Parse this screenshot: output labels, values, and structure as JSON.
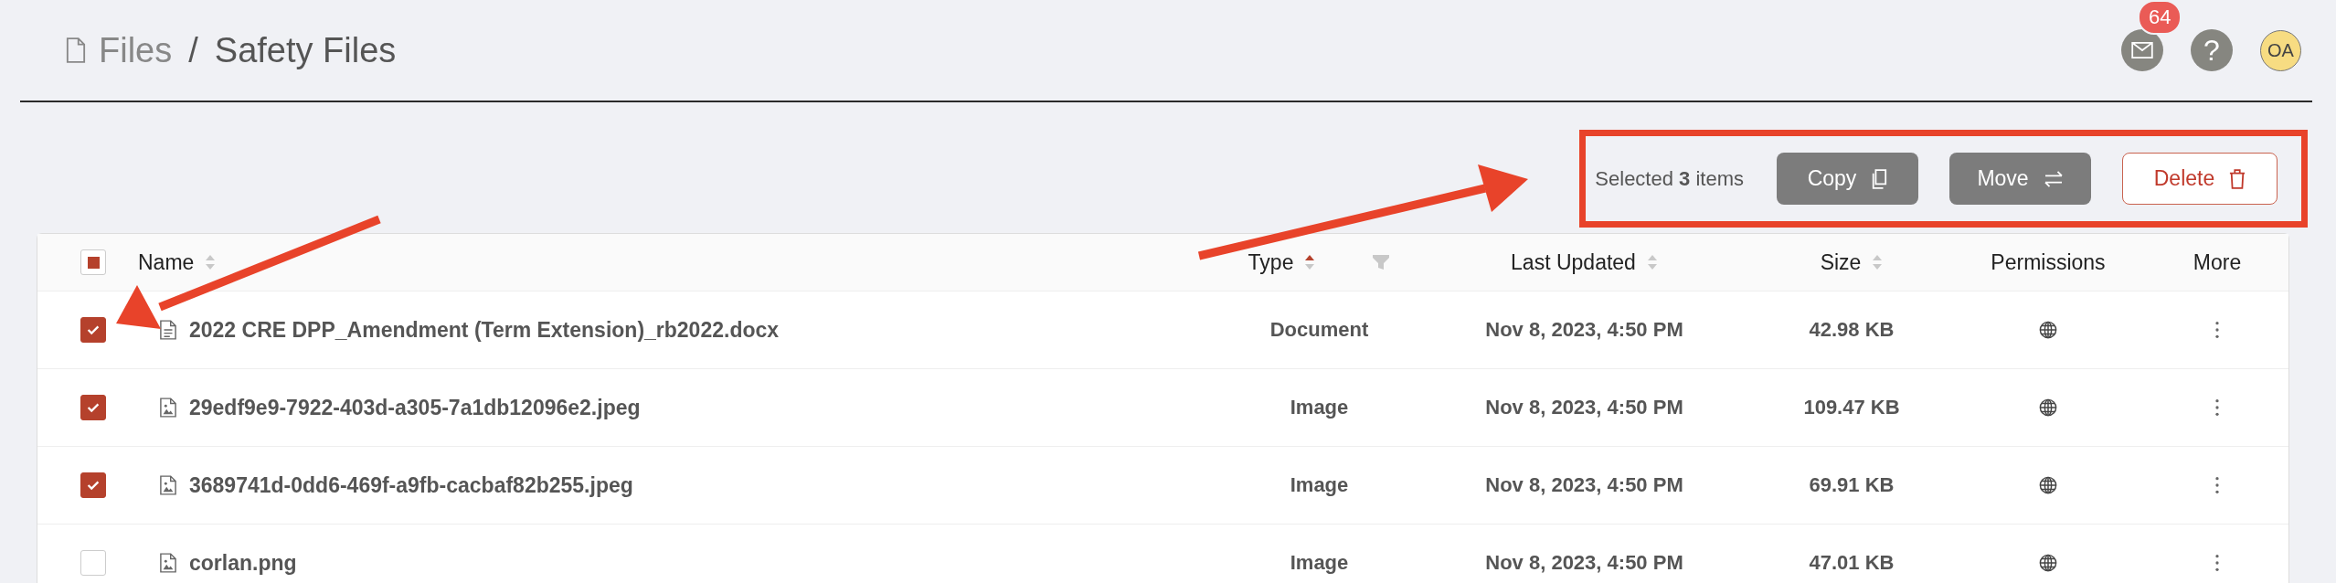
{
  "breadcrumb": {
    "root": "Files",
    "separator": "/",
    "current": "Safety Files"
  },
  "header_actions": {
    "mail_count": "64",
    "help": "?",
    "avatar": "OA"
  },
  "selection_bar": {
    "highlighted": true,
    "prefix": "Selected ",
    "count": "3",
    "suffix": " items",
    "buttons": [
      {
        "label": "Copy",
        "kind": "copy"
      },
      {
        "label": "Move",
        "kind": "move"
      },
      {
        "label": "Delete",
        "kind": "delete"
      }
    ]
  },
  "table": {
    "select_all": {
      "indeterminate": true
    },
    "columns": [
      {
        "label": "Name",
        "sortable": true,
        "sorted_ascending": false,
        "filter": false
      },
      {
        "label": "Type",
        "sortable": true,
        "sorted_ascending": true,
        "filter": true
      },
      {
        "label": "Last Updated",
        "sortable": true,
        "sorted_ascending": false,
        "filter": false
      },
      {
        "label": "Size",
        "sortable": true,
        "sorted_ascending": false,
        "filter": false
      },
      {
        "label": "Permissions",
        "sortable": false,
        "filter": false
      },
      {
        "label": "More",
        "sortable": false,
        "filter": false
      }
    ],
    "rows": [
      {
        "selected": true,
        "kind": "document",
        "name": "2022 CRE DPP_Amendment (Term Extension)_rb2022.docx",
        "type": "Document",
        "updated": "Nov 8, 2023, 4:50 PM",
        "size": "42.98 KB",
        "public": true
      },
      {
        "selected": true,
        "kind": "image",
        "name": "29edf9e9-7922-403d-a305-7a1db12096e2.jpeg",
        "type": "Image",
        "updated": "Nov 8, 2023, 4:50 PM",
        "size": "109.47 KB",
        "public": true
      },
      {
        "selected": true,
        "kind": "image",
        "name": "3689741d-0dd6-469f-a9fb-cacbaf82b255.jpeg",
        "type": "Image",
        "updated": "Nov 8, 2023, 4:50 PM",
        "size": "69.91 KB",
        "public": true
      },
      {
        "selected": false,
        "kind": "image",
        "name": "corlan.png",
        "type": "Image",
        "updated": "Nov 8, 2023, 4:50 PM",
        "size": "47.01 KB",
        "public": true
      }
    ]
  }
}
